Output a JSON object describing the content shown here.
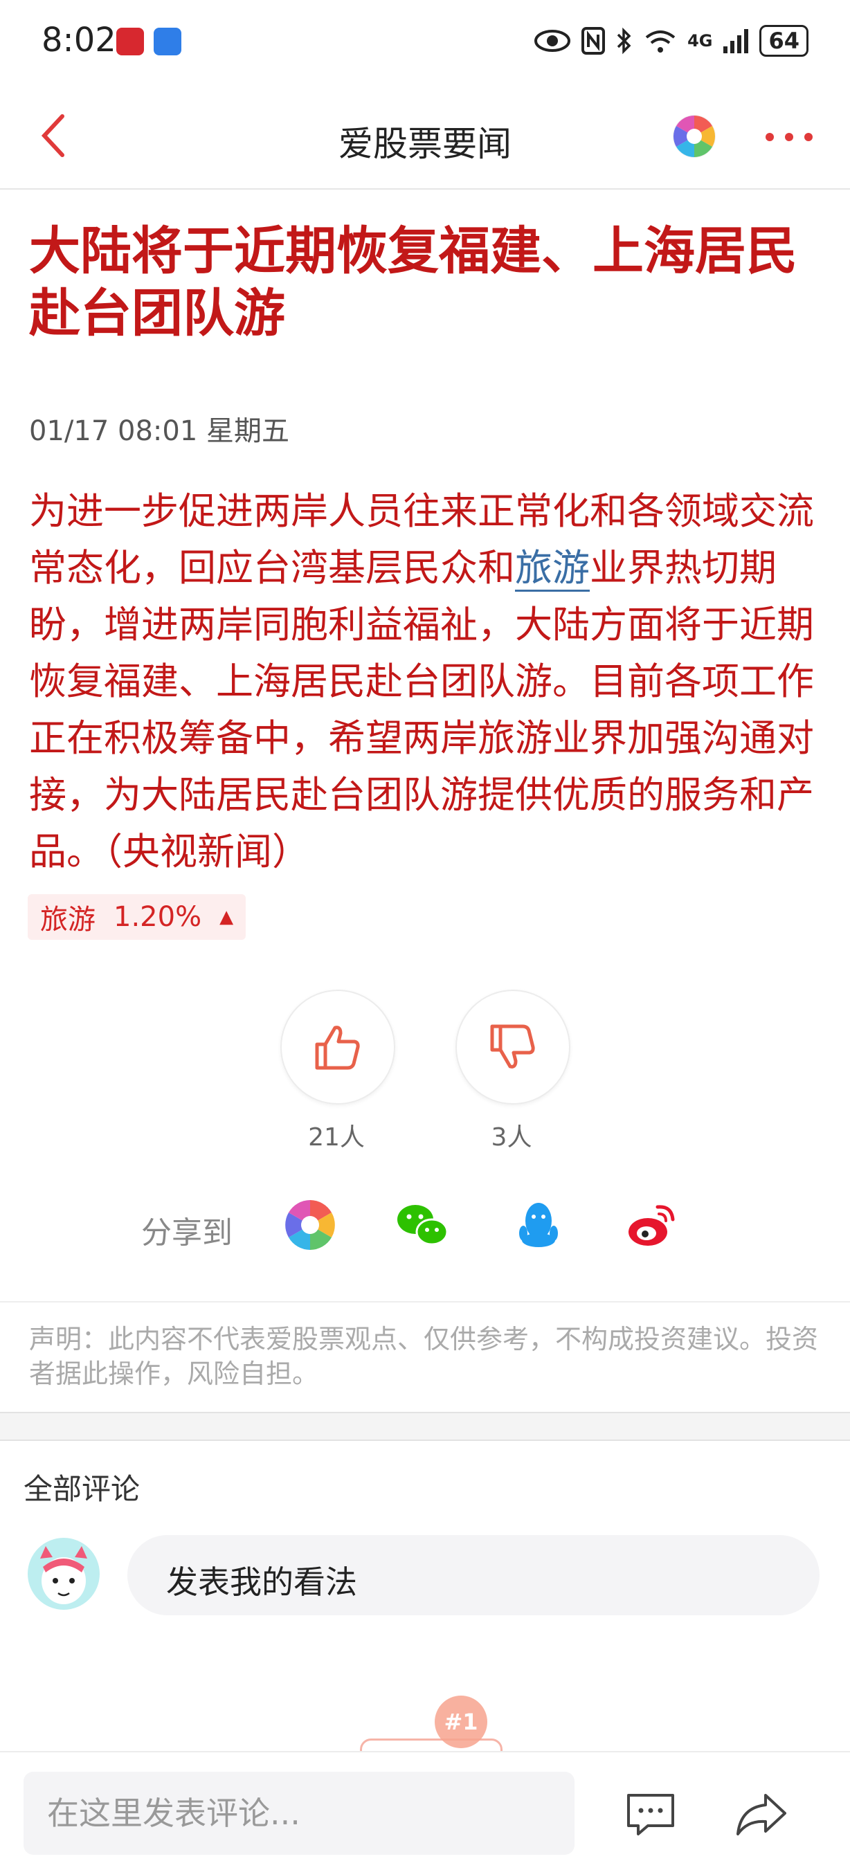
{
  "status_bar": {
    "time": "8:02",
    "battery": "64",
    "network": "4G",
    "icons": [
      "eye-icon",
      "nfc-icon",
      "bluetooth-icon",
      "wifi-icon",
      "signal-icon",
      "battery-icon"
    ]
  },
  "nav": {
    "title": "爱股票要闻",
    "back_icon": "chevron-left-icon",
    "more_icon": "more-dots-icon"
  },
  "article": {
    "headline": "大陆将于近期恢复福建、上海居民赴台团队游",
    "date": "01/17 08:01 星期五",
    "body_before": "为进一步促进两岸人员往来正常化和各领域交流常态化，回应台湾基层民众和",
    "body_link": "旅游",
    "body_after": "业界热切期盼，增进两岸同胞利益福祉，大陆方面将于近期恢复福建、上海居民赴台团队游。目前各项工作正在积极筹备中，希望两岸旅游业界加强沟通对接，为大陆居民赴台团队游提供优质的服务和产品。（央视新闻）",
    "tag": {
      "name": "旅游",
      "change": "1.20%",
      "direction": "▲",
      "color": "#d42424"
    }
  },
  "votes": {
    "like_count": "21人",
    "dislike_count": "3人"
  },
  "share": {
    "label": "分享到",
    "targets": [
      "aigupiao-icon",
      "wechat-icon",
      "qq-icon",
      "weibo-icon"
    ]
  },
  "disclaimer": "声明：此内容不代表爱股票观点、仅供参考，不构成投资建议。投资者据此操作，风险自担。",
  "comments": {
    "title": "全部评论",
    "opinion_prompt": "发表我的看法"
  },
  "floating_badge": "#1",
  "bottom_bar": {
    "input_placeholder": "在这里发表评论..."
  },
  "colors": {
    "accent_red": "#c21818",
    "link_blue": "#3a6ea5"
  }
}
